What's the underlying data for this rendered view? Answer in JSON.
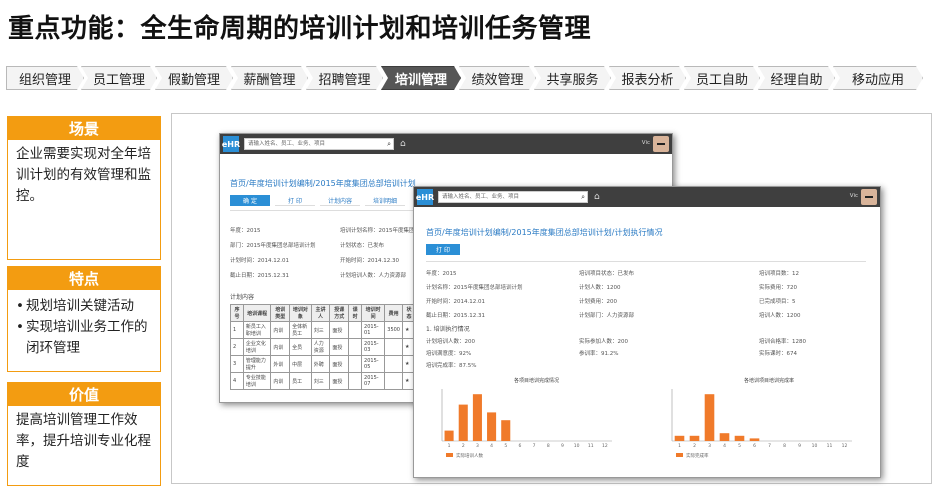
{
  "title": "重点功能：全生命周期的培训计划和培训任务管理",
  "tabs": [
    {
      "label": "组织管理",
      "active": false
    },
    {
      "label": "员工管理",
      "active": false
    },
    {
      "label": "假勤管理",
      "active": false
    },
    {
      "label": "薪酬管理",
      "active": false
    },
    {
      "label": "招聘管理",
      "active": false
    },
    {
      "label": "培训管理",
      "active": true
    },
    {
      "label": "绩效管理",
      "active": false
    },
    {
      "label": "共享服务",
      "active": false
    },
    {
      "label": "报表分析",
      "active": false
    },
    {
      "label": "员工自助",
      "active": false
    },
    {
      "label": "经理自助",
      "active": false
    },
    {
      "label": "移动应用",
      "active": false
    }
  ],
  "sidebar": {
    "scene": {
      "heading": "场景",
      "text": "企业需要实现对全年培训计划的有效管理和监控。"
    },
    "features": {
      "heading": "特点",
      "items": [
        "规划培训关键活动",
        "实现培训业务工作的闭环管理"
      ]
    },
    "value": {
      "heading": "价值",
      "text": "提高培训管理工作效率，提升培训专业化程度"
    }
  },
  "colors": {
    "accent": "#f39c11",
    "tab_active": "#565656",
    "link": "#2b7bc4",
    "chart_bar": "#f07a2a"
  },
  "screens": {
    "back": {
      "logo": "eHR",
      "search_placeholder": "请输入姓名、员工、业务、项目",
      "user": "Vic",
      "breadcrumb": "首页/年度培训计划编制/2015年度集团总部培训计划",
      "btn_primary": "确 定",
      "btn_tabs": [
        "打 印",
        "计划内容",
        "培训明细"
      ],
      "fields": [
        {
          "text": "年度：2015"
        },
        {
          "text": "培训计划名称：2015年度集团总部"
        },
        {
          "text": "部门：2015年度集团总部培训计划"
        },
        {
          "text": "计划状态：已发布"
        },
        {
          "text": "计划时间：2014.12.01"
        },
        {
          "text": "开始时间：2014.12.30"
        },
        {
          "text": "截止日期：2015.12.31"
        },
        {
          "text": "计划培训人数：人力资源部"
        }
      ],
      "section_title": "计划内容",
      "table": {
        "headers": [
          "序号",
          "培训课程",
          "培训类型",
          "培训对象",
          "主讲人",
          "授课方式",
          "课时",
          "培训时间",
          "费用",
          "状态"
        ],
        "rows": [
          [
            "1",
            "新员工入职培训",
            "内训",
            "全体新员工",
            "刘三",
            "面授",
            "",
            "2015-01",
            "3500",
            "★"
          ],
          [
            "2",
            "企业文化培训",
            "内训",
            "全员",
            "人力资源",
            "面授",
            "",
            "2015-03",
            "",
            "★"
          ],
          [
            "3",
            "管理能力提升",
            "外训",
            "中层",
            "外聘",
            "面授",
            "",
            "2015-05",
            "",
            "★"
          ],
          [
            "4",
            "专业技能培训",
            "内训",
            "员工",
            "刘三",
            "面授",
            "",
            "2015-07",
            "",
            "★"
          ]
        ]
      }
    },
    "front": {
      "logo": "eHR",
      "search_placeholder": "请输入姓名、员工、业务、项目",
      "user": "Vic",
      "breadcrumb": "首页/年度培训计划编制/2015年度集团总部培训计划/计划执行情况",
      "btn_primary": "打 印",
      "fields": [
        {
          "text": "年度：2015"
        },
        {
          "text": "计划名称：2015年度集团总部培训计划"
        },
        {
          "text": "开始时间：2014.12.01"
        },
        {
          "text": "截止日期：2015.12.31"
        },
        {
          "text": "培训项目状态：已发布"
        },
        {
          "text": "计划人数：1200"
        },
        {
          "text": "计划费用：200"
        },
        {
          "text": "计划部门：人力资源部"
        },
        {
          "text": "培训项目数：12"
        },
        {
          "text": "实际费用：720"
        },
        {
          "text": "已完成项目：5"
        },
        {
          "text": "培训人数：1200"
        }
      ],
      "section_title": "1. 培训执行情况",
      "stats": [
        {
          "text": "计划培训人数：200"
        },
        {
          "text": "实际参加人数：200"
        },
        {
          "text": "培训满意度：92%"
        },
        {
          "text": "参训率：91.2%"
        },
        {
          "text": "培训合格率：1280"
        },
        {
          "text": "实际课时：674"
        },
        {
          "text": "培训完成率：87.5%"
        }
      ],
      "charts": [
        {
          "title": "各项目培训完成情况",
          "legend": "实际培训人数",
          "categories": [
            "1",
            "2",
            "3",
            "4",
            "5",
            "6",
            "7",
            "8",
            "9",
            "10",
            "11",
            "12"
          ],
          "values": [
            20,
            70,
            90,
            55,
            40,
            0,
            0,
            0,
            0,
            0,
            0,
            0
          ]
        },
        {
          "title": "各培训项目培训完成率",
          "legend": "实际完成率",
          "categories": [
            "1",
            "2",
            "3",
            "4",
            "5",
            "6",
            "7",
            "8",
            "9",
            "10",
            "11",
            "12"
          ],
          "values": [
            10,
            10,
            90,
            15,
            10,
            5,
            0,
            0,
            0,
            0,
            0,
            0
          ]
        }
      ]
    }
  }
}
